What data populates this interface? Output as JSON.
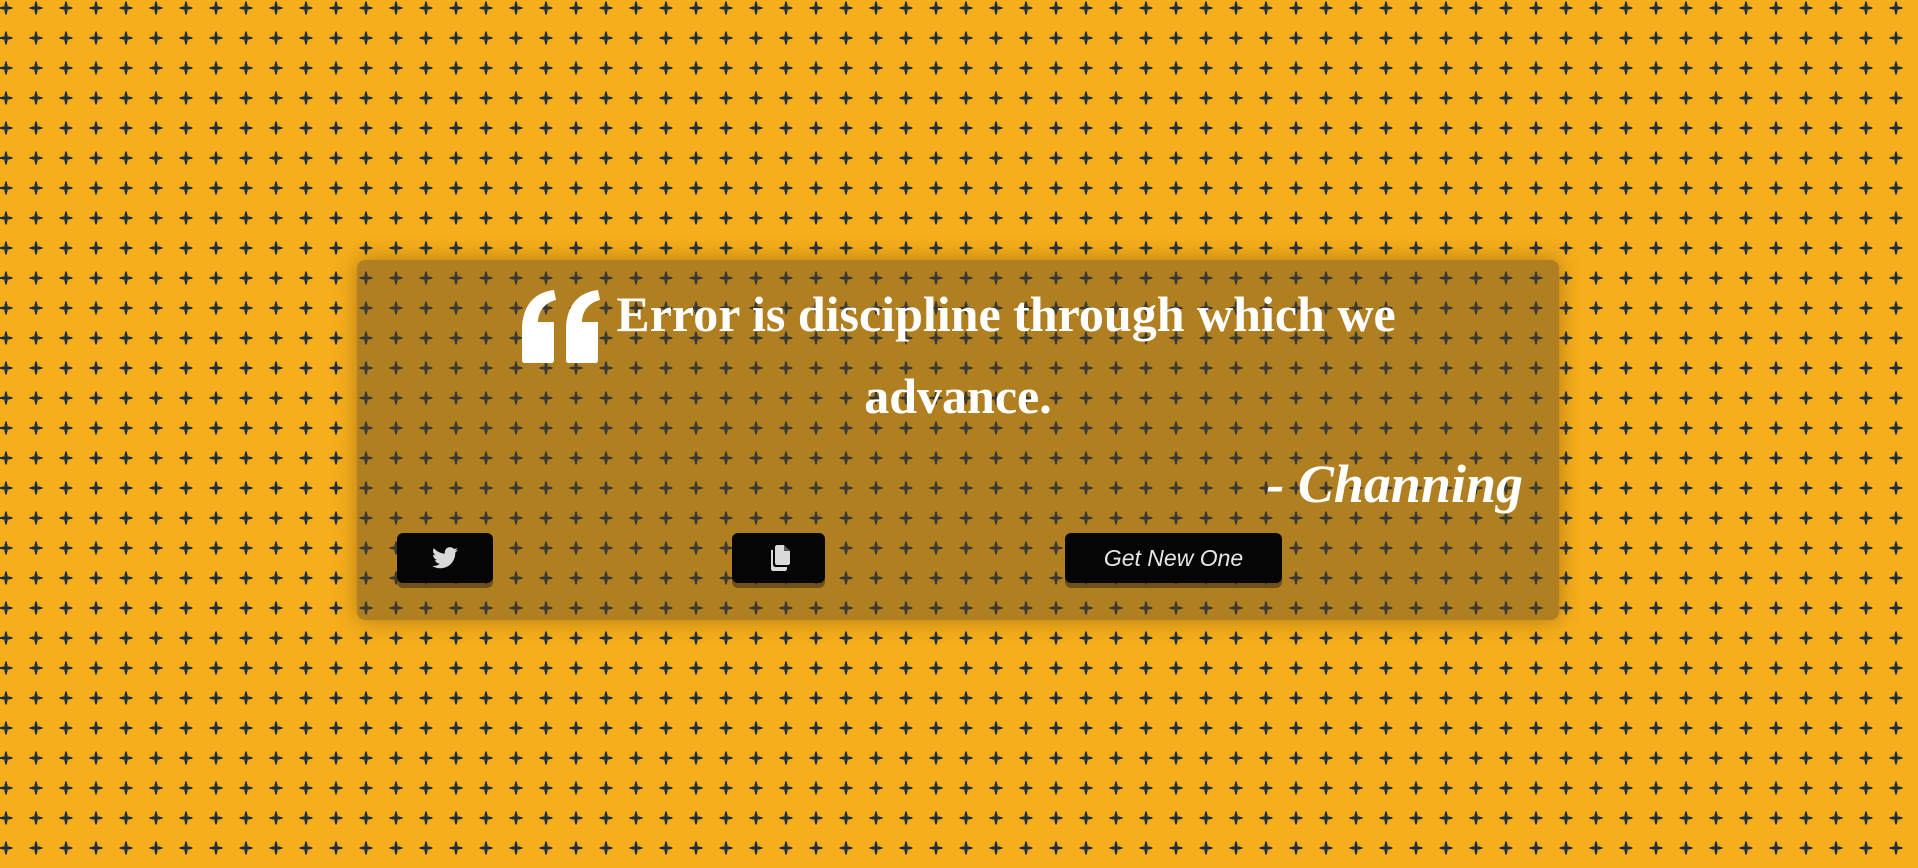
{
  "quote": {
    "text": "Error is discipline through which we advance.",
    "author": "- Channing"
  },
  "actions": {
    "tweet_icon": "twitter-icon",
    "copy_icon": "copy-icon",
    "new_label": "Get New One"
  },
  "colors": {
    "background": "#f6ae1c",
    "pattern": "#1f2f3a",
    "button": "#050505",
    "text": "#ffffff"
  }
}
